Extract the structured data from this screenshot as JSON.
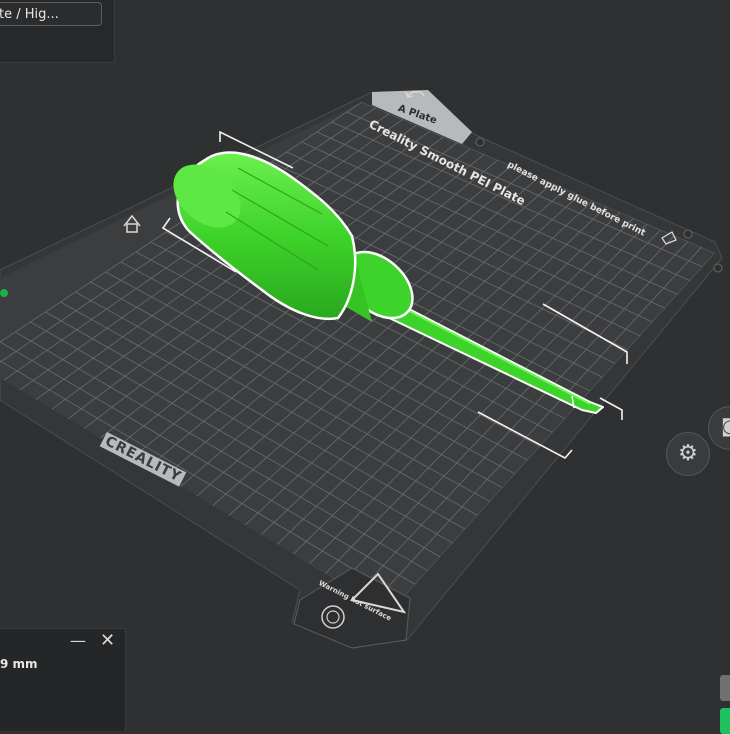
{
  "toolbar": {
    "preset_value": "te / Hig..."
  },
  "plate": {
    "tab_label": "A Plate",
    "title": "Creality Smooth PEI Plate",
    "note": "please apply glue before print",
    "brand": "CREALITY",
    "warning": "Warning hot surface"
  },
  "measure_panel": {
    "minimize_label": "—",
    "close_label": "✕",
    "value": "9 mm"
  },
  "icons": {
    "settings": "⚙",
    "camera": "◙"
  },
  "colors": {
    "background": "#2f3031",
    "bed": "#3b3c3e",
    "grid": "#6a6b6d",
    "model": "#3ed32a",
    "accent": "#1fc15e"
  }
}
